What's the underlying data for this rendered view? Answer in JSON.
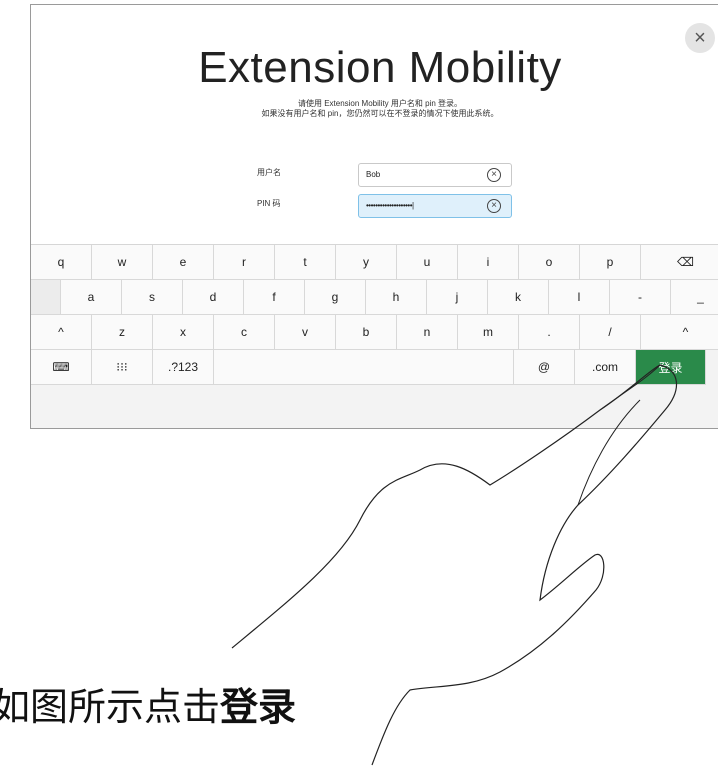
{
  "dialog": {
    "title": "Extension Mobility",
    "subtitle_line1": "请使用 Extension Mobility 用户名和 pin 登录。",
    "subtitle_line2": "如果没有用户名和 pin，您仍然可以在不登录的情况下使用此系统。",
    "close_icon": "×"
  },
  "form": {
    "username_label": "用户名",
    "username_value": "Bob",
    "pin_label": "PIN 码",
    "pin_value": "••••••••••••••••••••|",
    "clear_icon": "×"
  },
  "keyboard": {
    "row1": [
      "q",
      "w",
      "e",
      "r",
      "t",
      "y",
      "u",
      "i",
      "o",
      "p",
      "⌫"
    ],
    "row2": [
      "a",
      "s",
      "d",
      "f",
      "g",
      "h",
      "j",
      "k",
      "l",
      "-",
      "_"
    ],
    "row3": [
      "^",
      "z",
      "x",
      "c",
      "v",
      "b",
      "n",
      "m",
      ".",
      "/",
      "^"
    ],
    "row4": {
      "hide_icon": "⌨",
      "grid_icon": "⁝⁝⁝",
      "symbols": ".?123",
      "at": "@",
      "dotcom": ".com",
      "login": "登录"
    }
  },
  "caption": {
    "prefix": "如图所示点击",
    "emphasis": "登录"
  }
}
